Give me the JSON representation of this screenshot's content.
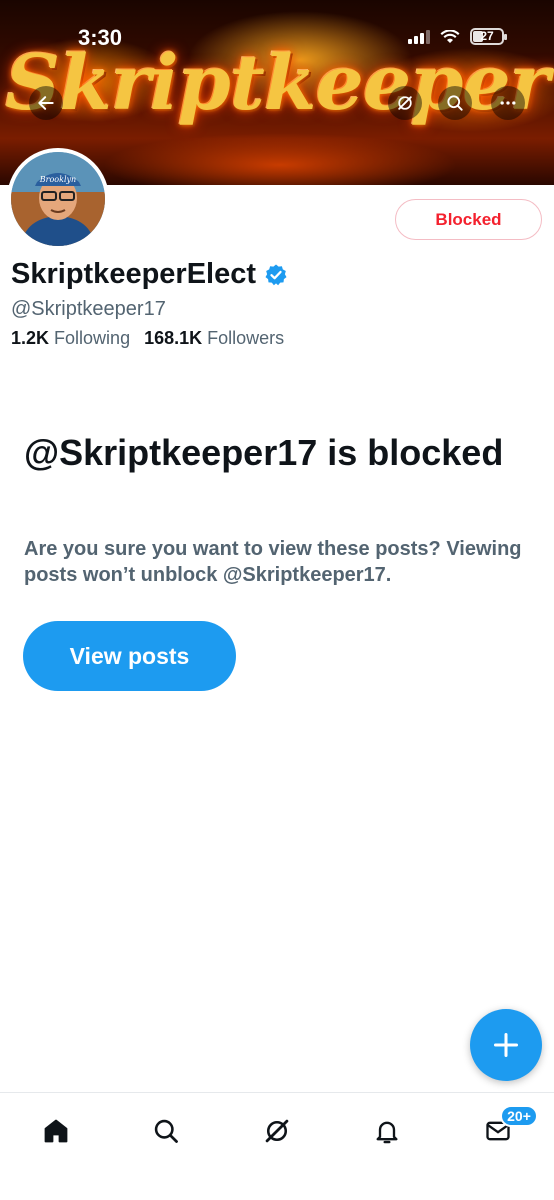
{
  "status_bar": {
    "time": "3:30",
    "battery": "27"
  },
  "banner": {
    "logo_text": "Skriptkeeper"
  },
  "header_actions": {
    "back_icon": "arrow-left-icon",
    "grok_icon": "grok-icon",
    "search_icon": "search-icon",
    "more_icon": "more-icon"
  },
  "profile": {
    "display_name": "SkriptkeeperElect",
    "handle": "@Skriptkeeper17",
    "following_count": "1.2K",
    "following_label": "Following",
    "followers_count": "168.1K",
    "followers_label": "Followers",
    "blocked_button_label": "Blocked",
    "avatar_cap_text": "Brooklyn"
  },
  "blocked_notice": {
    "title": "@Skriptkeeper17 is blocked",
    "description": "Are you sure you want to view these posts? Viewing posts won’t unblock @Skriptkeeper17.",
    "view_button_label": "View posts"
  },
  "tab_bar": {
    "items": [
      {
        "name": "home",
        "icon": "home-icon"
      },
      {
        "name": "search",
        "icon": "search-icon"
      },
      {
        "name": "grok",
        "icon": "grok-icon"
      },
      {
        "name": "notifications",
        "icon": "bell-icon"
      },
      {
        "name": "messages",
        "icon": "mail-icon",
        "badge": "20+"
      }
    ]
  },
  "colors": {
    "accent": "#1d9bf0",
    "blocked_red": "#f4212e",
    "secondary_text": "#536471"
  }
}
